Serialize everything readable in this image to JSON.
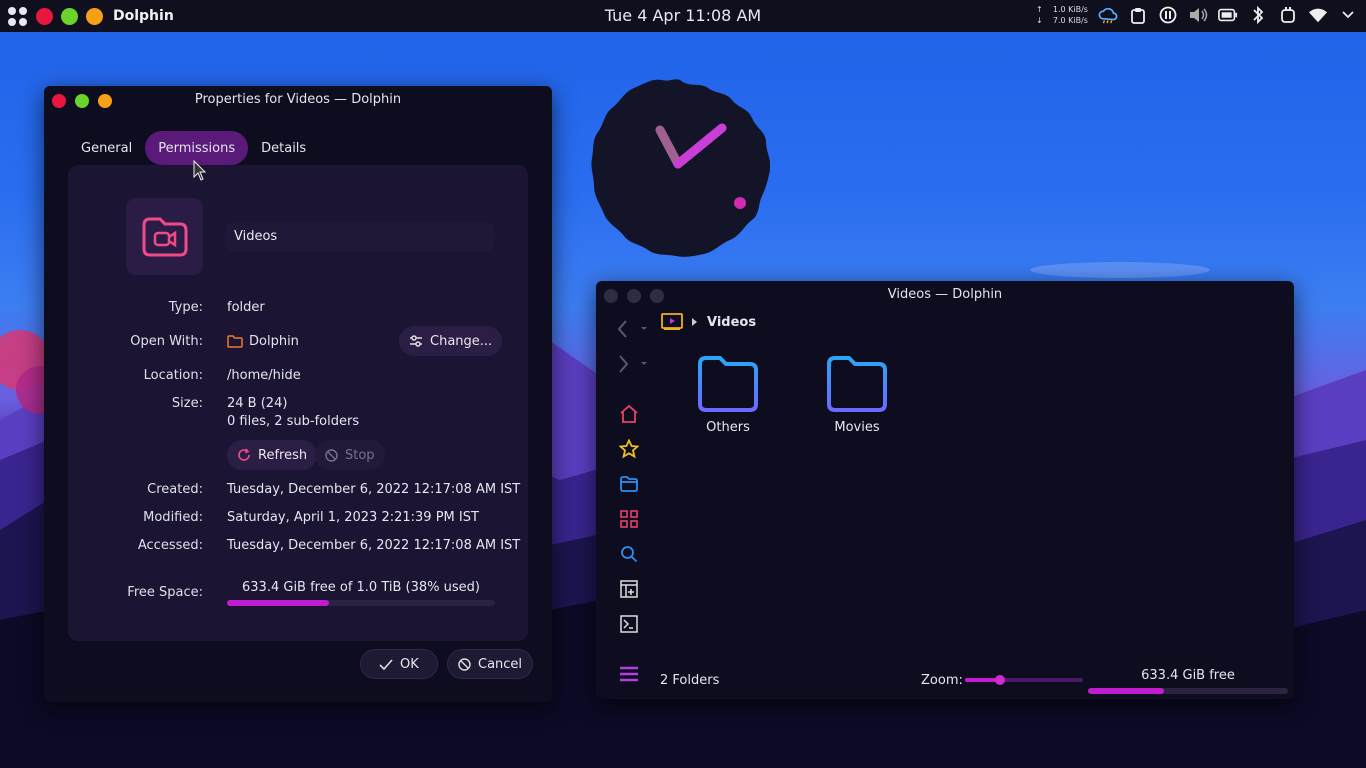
{
  "panel": {
    "app_name": "Dolphin",
    "clock": "Tue 4 Apr  11:08 AM",
    "net_up": "1.0 KiB/s",
    "net_down": "7.0 KiB/s",
    "up_arrow": "↑",
    "down_arrow": "↓"
  },
  "props": {
    "title": "Properties for Videos — Dolphin",
    "tabs": [
      {
        "label": "General"
      },
      {
        "label": "Permissions"
      },
      {
        "label": "Details"
      }
    ],
    "name_value": "Videos",
    "type_label": "Type:",
    "type_value": "folder",
    "open_with_label": "Open With:",
    "open_with_value": "Dolphin",
    "change_label": "Change...",
    "location_label": "Location:",
    "location_value": "/home/hide",
    "size_label": "Size:",
    "size_value": "24 B (24)",
    "size_detail": "0 files, 2 sub-folders",
    "refresh_label": "Refresh",
    "stop_label": "Stop",
    "created_label": "Created:",
    "created_value": "Tuesday, December 6, 2022 12:17:08 AM IST",
    "modified_label": "Modified:",
    "modified_value": "Saturday, April 1, 2023 2:21:39 PM IST",
    "accessed_label": "Accessed:",
    "accessed_value": "Tuesday, December 6, 2022 12:17:08 AM IST",
    "free_space_label": "Free Space:",
    "free_space_value": "633.4 GiB free of 1.0 TiB (38% used)",
    "used_fraction": 0.38,
    "ok_label": "OK",
    "cancel_label": "Cancel"
  },
  "dolphin": {
    "title": "Videos — Dolphin",
    "breadcrumb": "Videos",
    "folders": [
      {
        "label": "Others"
      },
      {
        "label": "Movies"
      }
    ],
    "status": "2 Folders",
    "zoom_label": "Zoom:",
    "zoom_fraction": 0.3,
    "free_label": "633.4 GiB free",
    "free_used_fraction": 0.38
  },
  "colors": {
    "accent": "#c21cd0",
    "tab_active": "#5a1a7a",
    "close": "#e8173f",
    "maximize": "#6ad42a",
    "minimize": "#f5a017",
    "folder_blue": "#2f8ef0"
  }
}
